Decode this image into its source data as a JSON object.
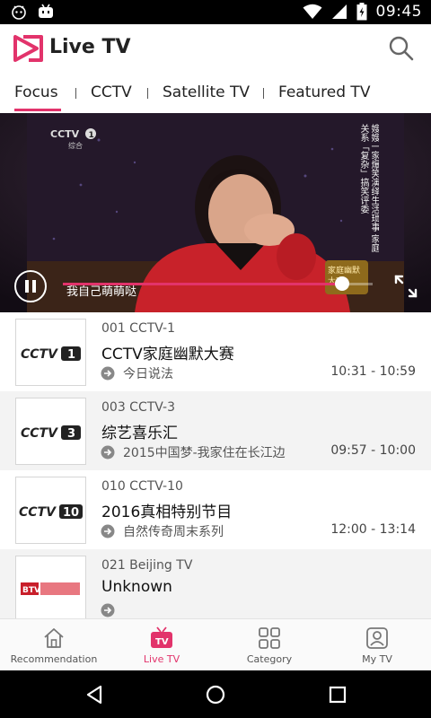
{
  "status_bar": {
    "time": "09:45"
  },
  "app": {
    "title": "Live TV"
  },
  "tabs": [
    "Focus",
    "CCTV",
    "Satellite TV",
    "Featured TV"
  ],
  "video": {
    "channel_logo": "CCTV",
    "channel_sub": "综合",
    "caption": "我自己萌萌哒",
    "side_text": "嫂嫂一家爆笑演绎生活琐事 家庭关系「复杂」搞笑评委",
    "show_badge": "家庭幽默大赛",
    "progress": 0.9
  },
  "channels": [
    {
      "number_label": "001 CCTV-1",
      "now": "CCTV家庭幽默大赛",
      "next": "今日说法",
      "time": "10:31 - 10:59",
      "logo_num": "1"
    },
    {
      "number_label": "003 CCTV-3",
      "now": "综艺喜乐汇",
      "next": "2015中国梦-我家住在长江边",
      "time": "09:57 - 10:00",
      "logo_num": "3"
    },
    {
      "number_label": "010 CCTV-10",
      "now": "2016真相特别节目",
      "next": "自然传奇周末系列",
      "time": "12:00 - 13:14",
      "logo_num": "10"
    },
    {
      "number_label": "021 Beijing TV",
      "now": "Unknown",
      "next": "",
      "time": "",
      "logo_num": ""
    }
  ],
  "bottom_nav": [
    "Recommendation",
    "Live TV",
    "Category",
    "My TV"
  ],
  "colors": {
    "accent": "#e2336b"
  }
}
